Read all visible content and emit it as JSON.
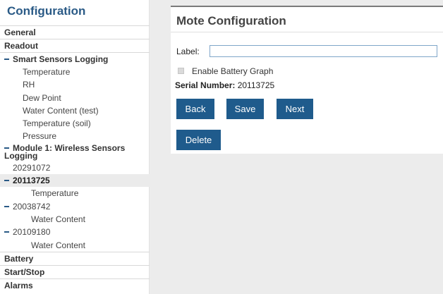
{
  "sidebar": {
    "title": "Configuration",
    "general": "General",
    "readout": "Readout",
    "smart_logging": {
      "label": "Smart Sensors Logging",
      "items": [
        "Temperature",
        "RH",
        "Dew Point",
        "Water Content (test)",
        "Temperature (soil)",
        "Pressure"
      ]
    },
    "module": {
      "label": "Module 1: Wireless Sensors Logging",
      "mote_1": "20291072",
      "mote_2": {
        "id": "20113725",
        "child": "Temperature"
      },
      "mote_3": {
        "id": "20038742",
        "child": "Water Content"
      },
      "mote_4": {
        "id": "20109180",
        "child": "Water Content"
      }
    },
    "battery": "Battery",
    "start_stop": "Start/Stop",
    "alarms": "Alarms"
  },
  "main": {
    "title": "Mote Configuration",
    "label_field": {
      "label": "Label:",
      "value": ""
    },
    "battery_graph": {
      "label": "Enable Battery Graph",
      "checked": false
    },
    "serial_label": "Serial Number:",
    "serial_value": "20113725",
    "buttons": {
      "back": "Back",
      "save": "Save",
      "next": "Next",
      "delete": "Delete"
    }
  },
  "colors": {
    "accent": "#2a5a86",
    "button": "#1f5b8c",
    "background": "#ececec"
  }
}
